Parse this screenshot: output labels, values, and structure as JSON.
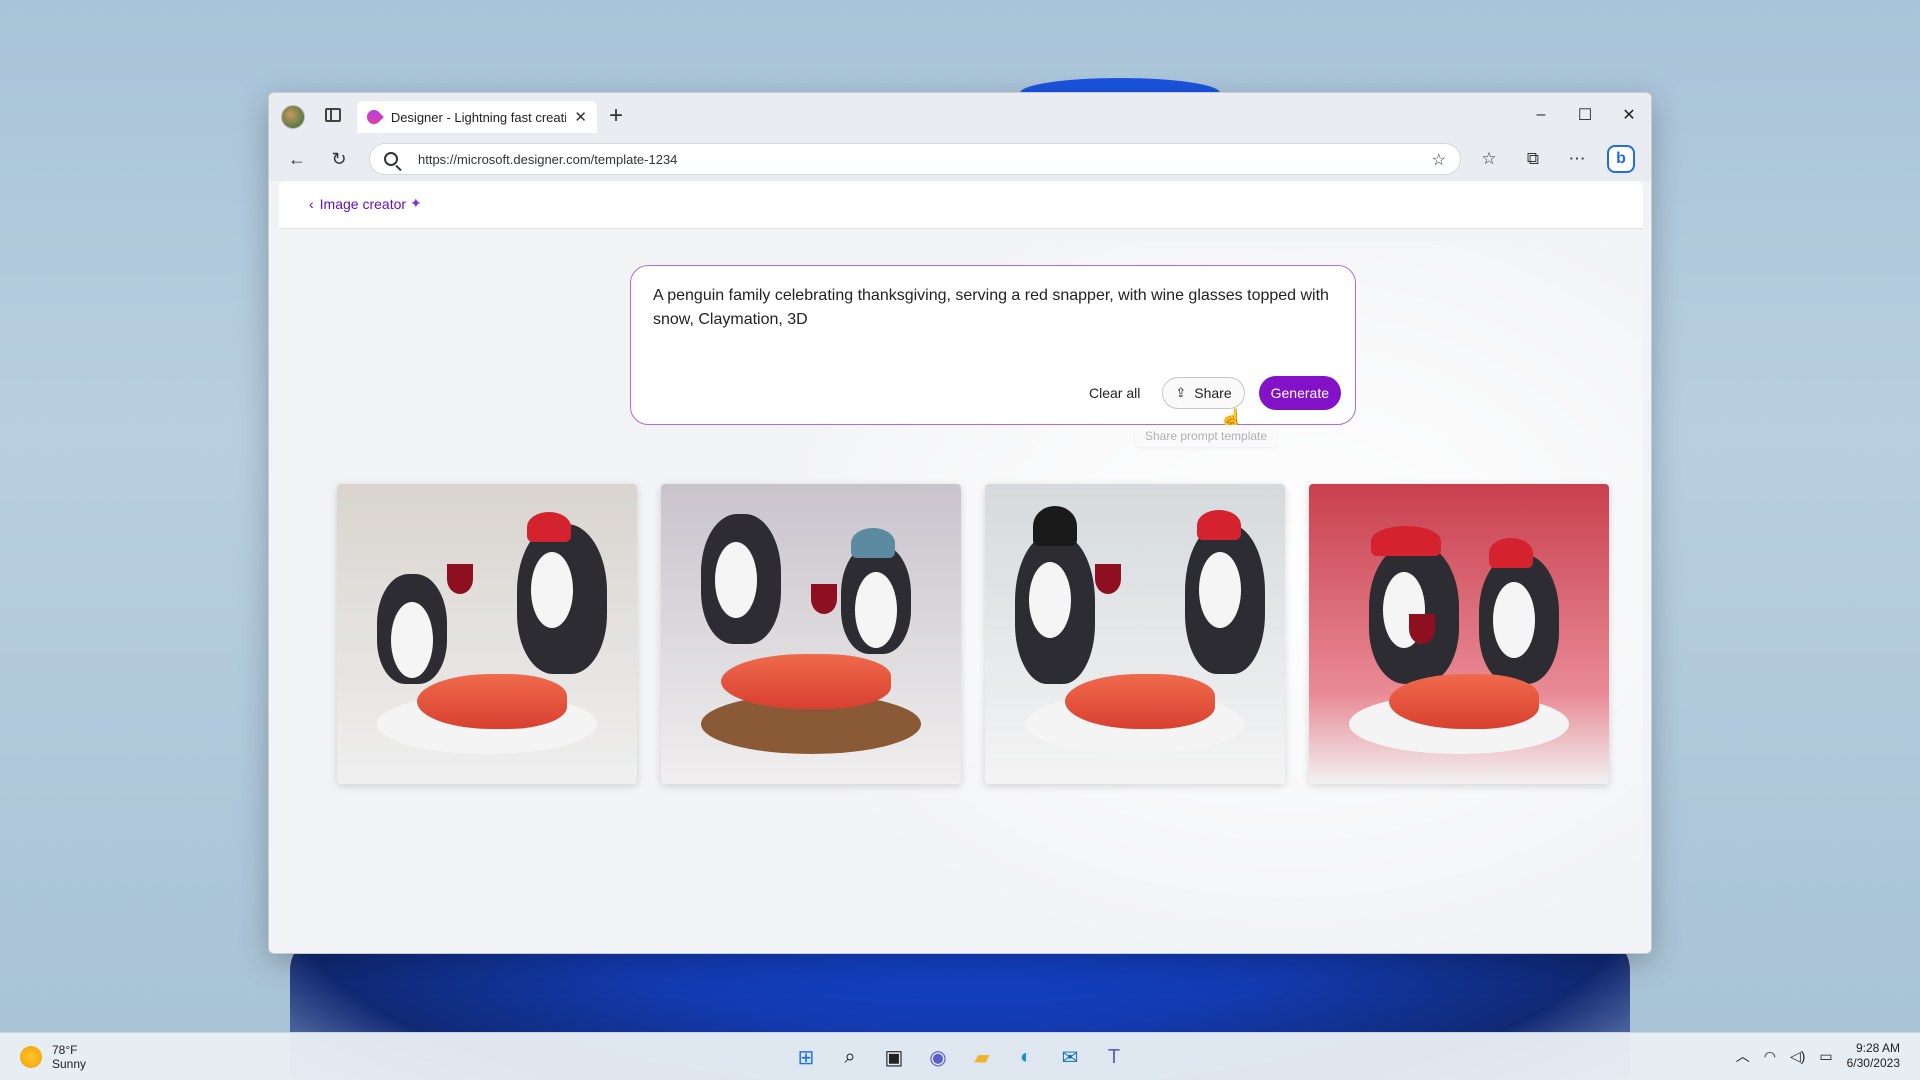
{
  "browser": {
    "tab_title": "Designer - Lightning fast creation",
    "url": "https://microsoft.designer.com/template-1234",
    "controls": {
      "minimize": "–",
      "maximize": "☐",
      "close": "✕"
    }
  },
  "page": {
    "back_label": "Image creator",
    "prompt": "A penguin family celebrating thanksgiving, serving a red snapper, with wine glasses topped with snow, Claymation, 3D",
    "clear_label": "Clear all",
    "share_label": "Share",
    "generate_label": "Generate",
    "tooltip": "Share prompt template",
    "images": [
      {
        "bg": "#d9d4cf"
      },
      {
        "bg": "#c9c4cc"
      },
      {
        "bg": "#d6dadd"
      },
      {
        "bg": "#c9404f"
      }
    ]
  },
  "taskbar": {
    "temperature": "78°F",
    "condition": "Sunny",
    "time": "9:28 AM",
    "date": "6/30/2023"
  },
  "colors": {
    "accent": "#8211c8",
    "link": "#6a0fb8"
  }
}
